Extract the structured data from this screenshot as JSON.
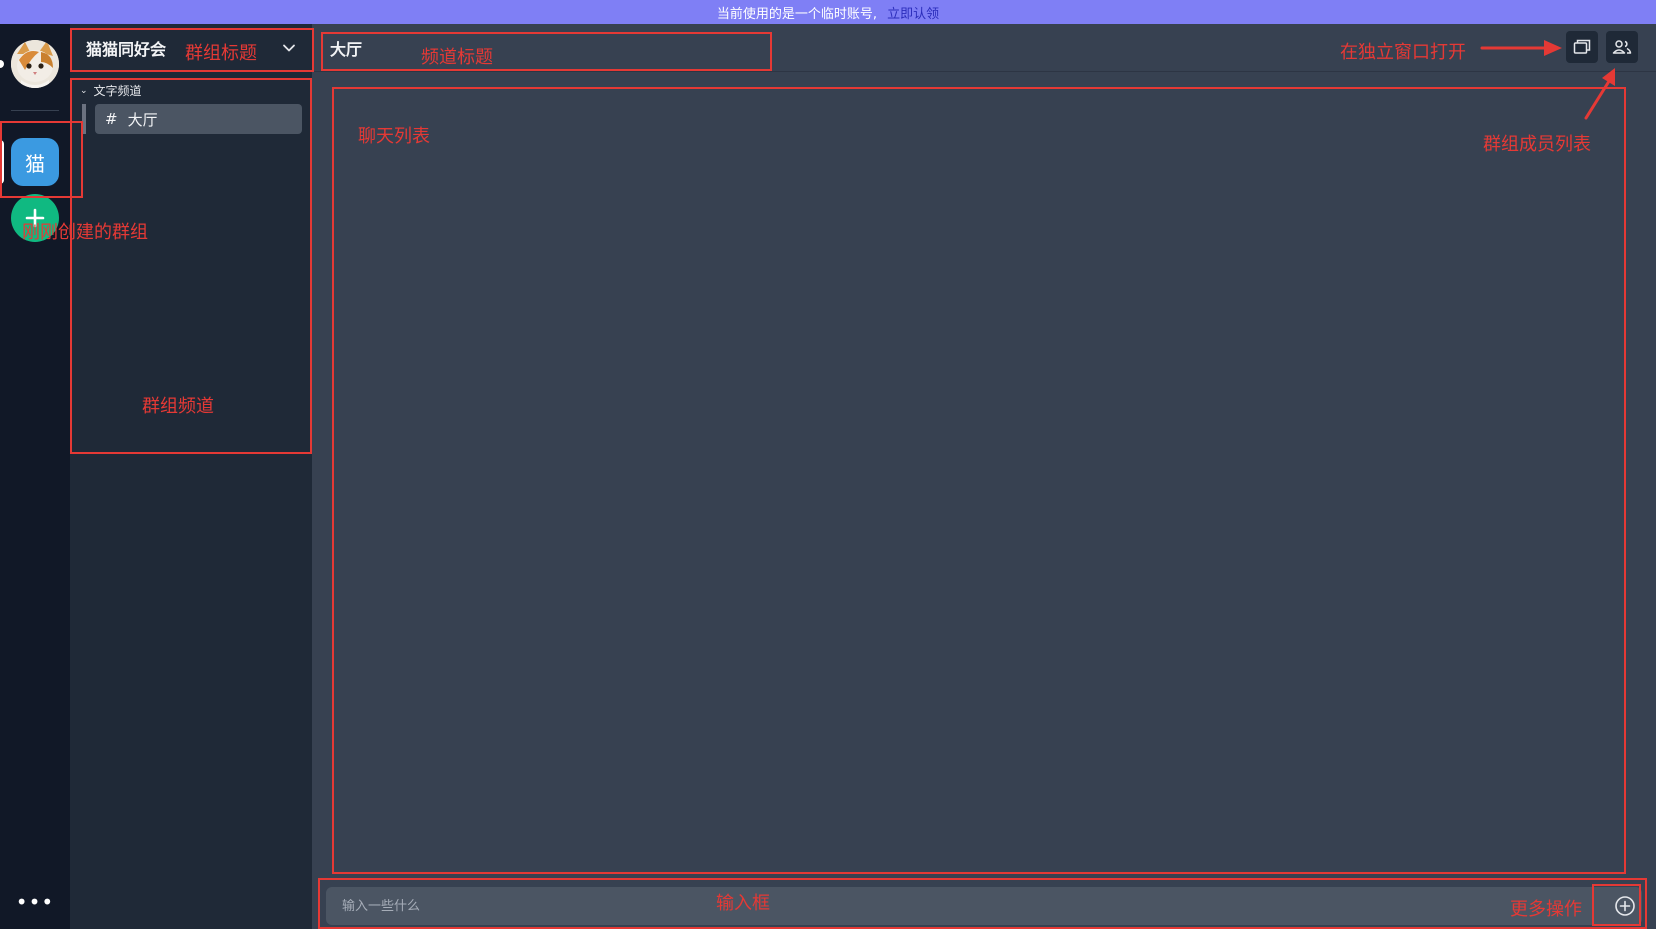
{
  "banner": {
    "notice": "当前使用的是一个临时账号,",
    "claim_link": "立即认领"
  },
  "rail": {
    "avatar": "cat-avatar",
    "server_label": "猫",
    "add_icon": "+",
    "more_icon": "•••"
  },
  "sidebar": {
    "group_title": "猫猫同好会",
    "section_label": "文字频道",
    "channels": [
      {
        "name": "大厅",
        "icon": "#"
      }
    ]
  },
  "main": {
    "channel_title": "大厅",
    "input_placeholder": "输入一些什么"
  },
  "annotations": {
    "group_title": "群组标题",
    "channel_title": "频道标题",
    "open_window": "在独立窗口打开",
    "member_list": "群组成员列表",
    "chat_list": "聊天列表",
    "new_group": "刚刚创建的群组",
    "group_channels": "群组频道",
    "input_box": "输入框",
    "more_actions": "更多操作",
    "color": "#e53935"
  }
}
